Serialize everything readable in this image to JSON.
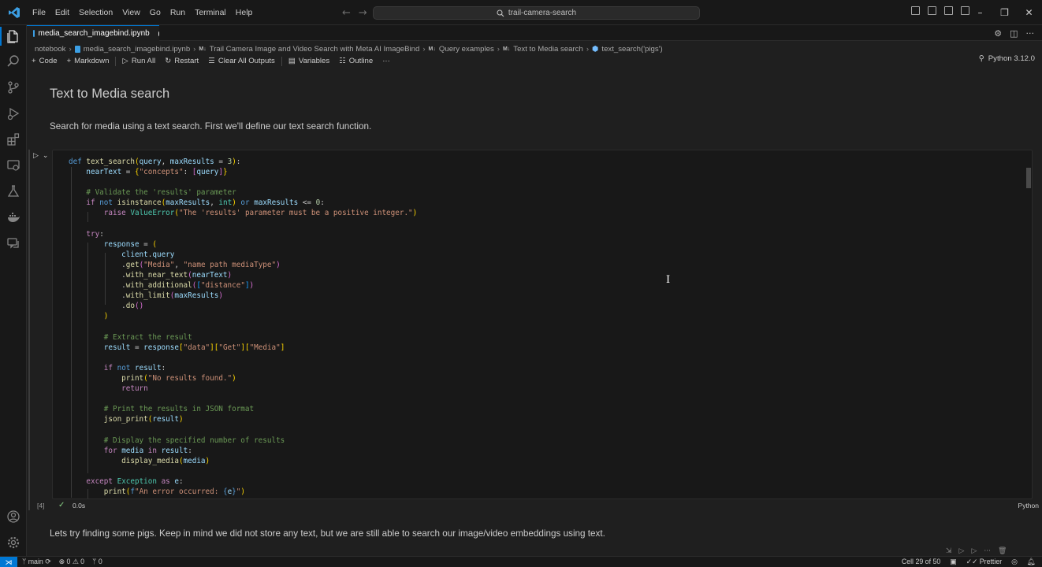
{
  "menu": [
    "File",
    "Edit",
    "Selection",
    "View",
    "Go",
    "Run",
    "Terminal",
    "Help"
  ],
  "search": {
    "text": "trail-camera-search"
  },
  "tab": {
    "label": "media_search_imagebind.ipynb"
  },
  "breadcrumb": {
    "root": "notebook",
    "file": "media_search_imagebind.ipynb",
    "s1_tag": "M↓",
    "s1": "Trail Camera Image and Video Search with Meta AI ImageBind",
    "s2_tag": "M↓",
    "s2": "Query examples",
    "s3_tag": "M↓",
    "s3": "Text to Media search",
    "s4": "text_search('pigs')"
  },
  "toolbar": {
    "code": "Code",
    "markdown": "Markdown",
    "run_all": "Run All",
    "restart": "Restart",
    "clear_outputs": "Clear All Outputs",
    "variables": "Variables",
    "outline": "Outline",
    "more": "···",
    "kernel": "Python 3.12.0"
  },
  "markdown": {
    "heading": "Text to Media search",
    "para1": "Search for media using a text search. First we'll define our text search function.",
    "para2": "Lets try finding some pigs. Keep in mind we did not store any text, but we are still able to search our image/video embeddings using text."
  },
  "cell": {
    "exec_count": "[4]",
    "exec_time": "0.0s",
    "language": "Python"
  },
  "statusbar": {
    "branch": "main",
    "errors": "0",
    "warnings": "0",
    "ports": "0",
    "cell_pos": "Cell 29 of 50",
    "prettier": "Prettier"
  }
}
